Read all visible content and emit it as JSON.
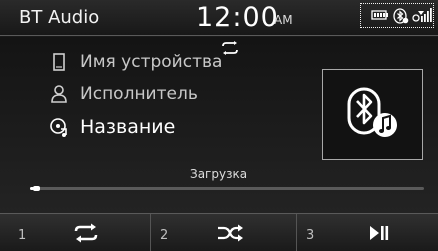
{
  "header": {
    "source": "BT Audio",
    "time": "12:00",
    "ampm": "AM",
    "status_icons": [
      "battery-icon",
      "bluetooth-icon",
      "signal-icon"
    ]
  },
  "track": {
    "device": "Имя устройства",
    "artist": "Исполнитель",
    "title": "Название",
    "status": "Загрузка",
    "progress": 0.01
  },
  "controls": [
    {
      "num": "1",
      "icon": "repeat-icon"
    },
    {
      "num": "2",
      "icon": "shuffle-icon"
    },
    {
      "num": "3",
      "icon": "play-pause-icon"
    }
  ],
  "colors": {
    "background": "#1a1a1a",
    "text": "#ffffff",
    "dim_text": "#c8c8c8"
  }
}
